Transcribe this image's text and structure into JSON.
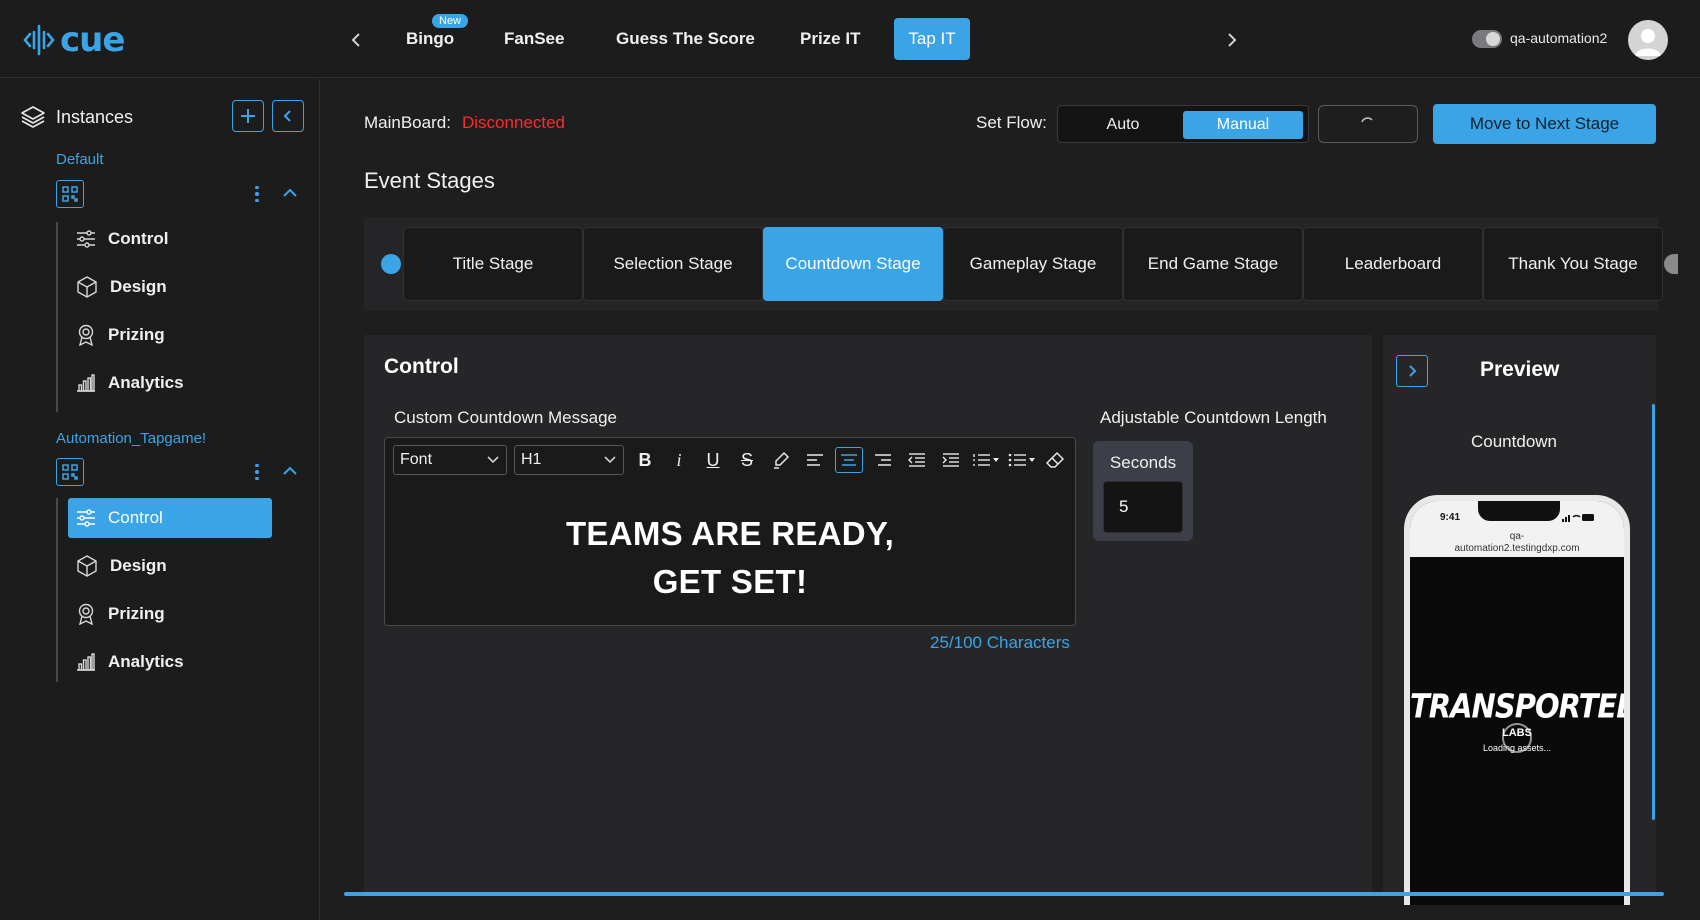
{
  "app": {
    "logo_text": "cue",
    "brand_color": "#3ba4e6",
    "status_error_color": "#ff2a2a"
  },
  "topnav": {
    "tabs": [
      {
        "label": "Bingo",
        "badge": "New"
      },
      {
        "label": "FanSee"
      },
      {
        "label": "Guess The Score"
      },
      {
        "label": "Prize IT"
      },
      {
        "label": "Tap IT",
        "active": true
      }
    ],
    "username": "qa-automation2"
  },
  "sidebar": {
    "title": "Instances",
    "groups": [
      {
        "name": "Default",
        "items": [
          "Control",
          "Design",
          "Prizing",
          "Analytics"
        ]
      },
      {
        "name": "Automation_Tapgame!",
        "items": [
          "Control",
          "Design",
          "Prizing",
          "Analytics"
        ],
        "active_item": "Control"
      }
    ]
  },
  "main": {
    "mainboard_label": "MainBoard:",
    "mainboard_status": "Disconnected",
    "setflow_label": "Set Flow:",
    "flow_options": [
      "Auto",
      "Manual"
    ],
    "flow_selected": "Manual",
    "next_button": "Move to Next Stage",
    "section_title": "Event Stages",
    "stages": [
      "Title Stage",
      "Selection Stage",
      "Countdown Stage",
      "Gameplay Stage",
      "End Game Stage",
      "Leaderboard",
      "Thank You Stage"
    ],
    "active_stage": "Countdown Stage"
  },
  "control": {
    "title": "Control",
    "message_label": "Custom Countdown Message",
    "font_select": "Font",
    "heading_select": "H1",
    "message_line1": "TEAMS ARE READY,",
    "message_line2": "GET SET!",
    "char_count": "25/100 Characters",
    "length_label": "Adjustable Countdown Length",
    "seconds_label": "Seconds",
    "seconds_value": "5"
  },
  "preview": {
    "title": "Preview",
    "subtitle": "Countdown",
    "phone_time": "9:41",
    "phone_url_line1": "qa-",
    "phone_url_line2": "automation2.testingdxp.com",
    "brand_text": "TRANSPORTED",
    "brand_sub": "LABS",
    "loading_text": "Loading assets..."
  }
}
